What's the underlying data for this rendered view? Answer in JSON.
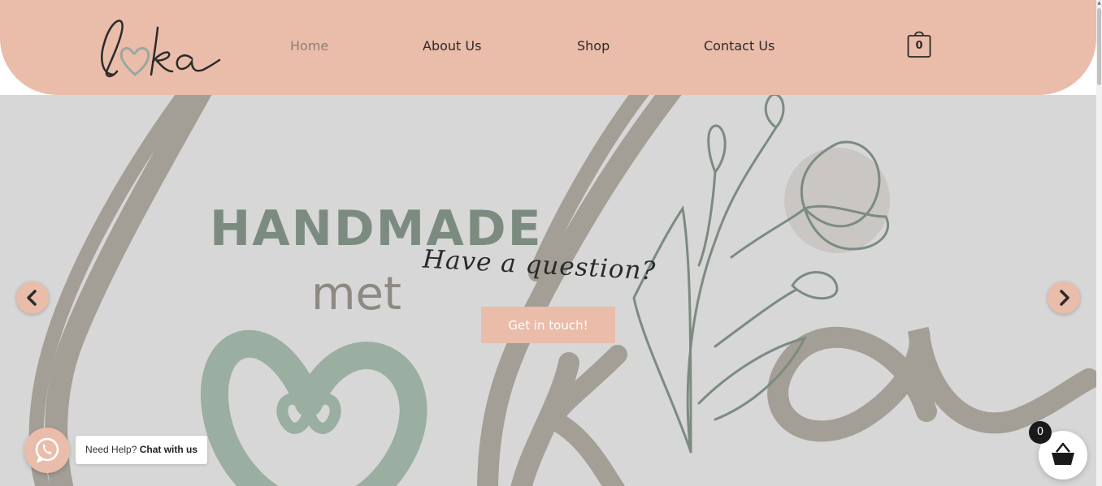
{
  "header": {
    "logo_text": "loka",
    "nav": [
      {
        "label": "Home",
        "active": true
      },
      {
        "label": "About Us",
        "active": false
      },
      {
        "label": "Shop",
        "active": false
      },
      {
        "label": "Contact Us",
        "active": false
      }
    ],
    "cart_count": "0"
  },
  "hero": {
    "headline": "HANDMADE",
    "subline": "met",
    "script_text": "Have a question?",
    "cta_label": "Get in touch!",
    "prev_icon": "chevron-left-icon",
    "next_icon": "chevron-right-icon"
  },
  "whatsapp": {
    "prefix": "Need Help?",
    "emphasis": "Chat with us",
    "icon": "whatsapp-icon"
  },
  "floating_cart": {
    "count": "0",
    "icon": "basket-icon"
  },
  "colors": {
    "accent": "#eabcaa",
    "hero_bg": "#d7d7d7",
    "sage": "#7c8b80",
    "taupe": "#a39e96",
    "text": "#2b2b2b"
  }
}
